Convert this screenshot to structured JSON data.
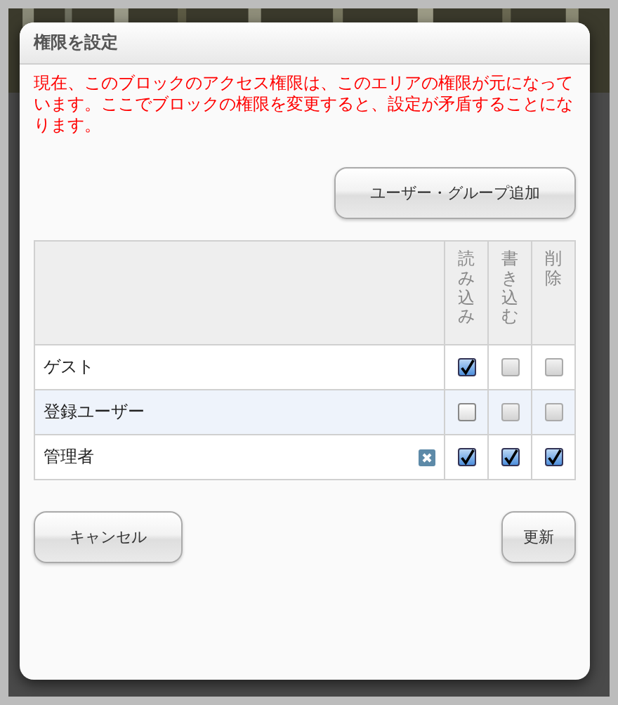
{
  "dialog": {
    "title": "権限を設定",
    "warning": "現在、このブロックのアクセス権限は、このエリアの権限が元になっています。ここでブロックの権限を変更すると、設定が矛盾することになります。",
    "add_button": "ユーザー・グループ追加"
  },
  "table": {
    "columns": [
      "読み込み",
      "書き込む",
      "削除"
    ],
    "rows": [
      {
        "name": "ゲスト",
        "removable": false,
        "highlighted": false,
        "permissions": [
          {
            "checked": true,
            "disabled": false
          },
          {
            "checked": false,
            "disabled": true
          },
          {
            "checked": false,
            "disabled": true
          }
        ]
      },
      {
        "name": "登録ユーザー",
        "removable": false,
        "highlighted": true,
        "permissions": [
          {
            "checked": false,
            "disabled": false
          },
          {
            "checked": false,
            "disabled": true
          },
          {
            "checked": false,
            "disabled": true
          }
        ]
      },
      {
        "name": "管理者",
        "removable": true,
        "highlighted": false,
        "permissions": [
          {
            "checked": true,
            "disabled": false
          },
          {
            "checked": true,
            "disabled": false
          },
          {
            "checked": true,
            "disabled": false
          }
        ]
      }
    ]
  },
  "buttons": {
    "cancel": "キャンセル",
    "submit": "更新"
  }
}
